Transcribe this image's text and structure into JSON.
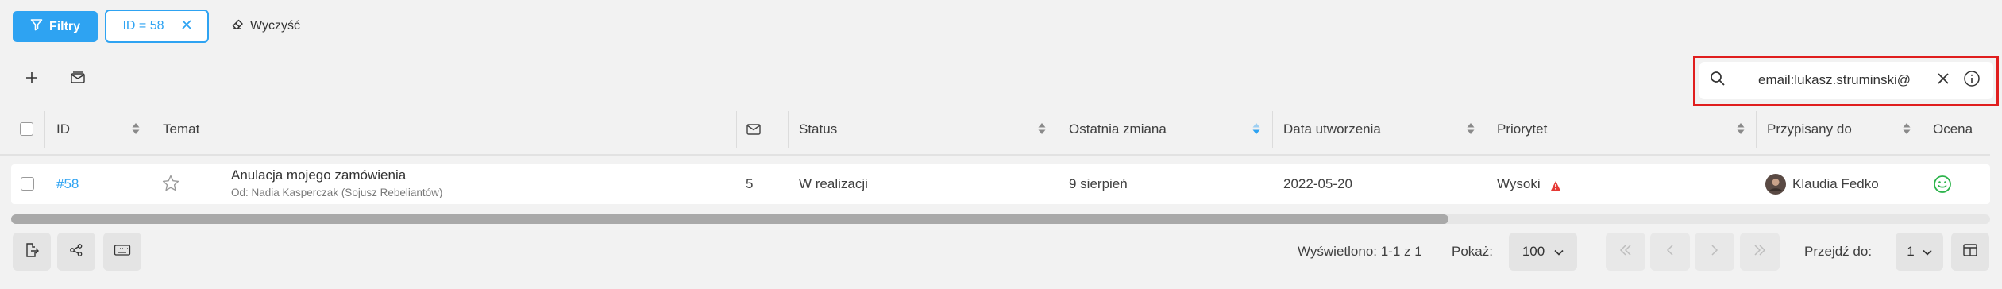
{
  "toolbar": {
    "filters_label": "Filtry",
    "active_filter_label": "ID = 58",
    "clear_label": "Wyczyść"
  },
  "search": {
    "value": "email:lukasz.struminski@"
  },
  "table": {
    "headers": {
      "id": "ID",
      "subject": "Temat",
      "status": "Status",
      "last_change": "Ostatnia zmiana",
      "created": "Data utworzenia",
      "priority": "Priorytet",
      "assigned": "Przypisany do",
      "rating": "Ocena"
    },
    "rows": [
      {
        "id": "#58",
        "subject": "Anulacja mojego zamówienia",
        "from": "Od:  Nadia Kasperczak (Sojusz Rebeliantów)",
        "messages": "5",
        "status": "W realizacji",
        "last_change": "9 sierpień",
        "created": "2022-05-20",
        "priority": "Wysoki",
        "assigned": "Klaudia Fedko"
      }
    ]
  },
  "footer": {
    "displayed": "Wyświetlono: 1-1 z 1",
    "show_label": "Pokaż:",
    "page_size": "100",
    "goto_label": "Przejdź do:",
    "goto_page": "1"
  },
  "colors": {
    "accent": "#2ea3f2",
    "highlight": "#e01e1e",
    "priority_high": "#e53935",
    "rating_good": "#2bb34a"
  }
}
